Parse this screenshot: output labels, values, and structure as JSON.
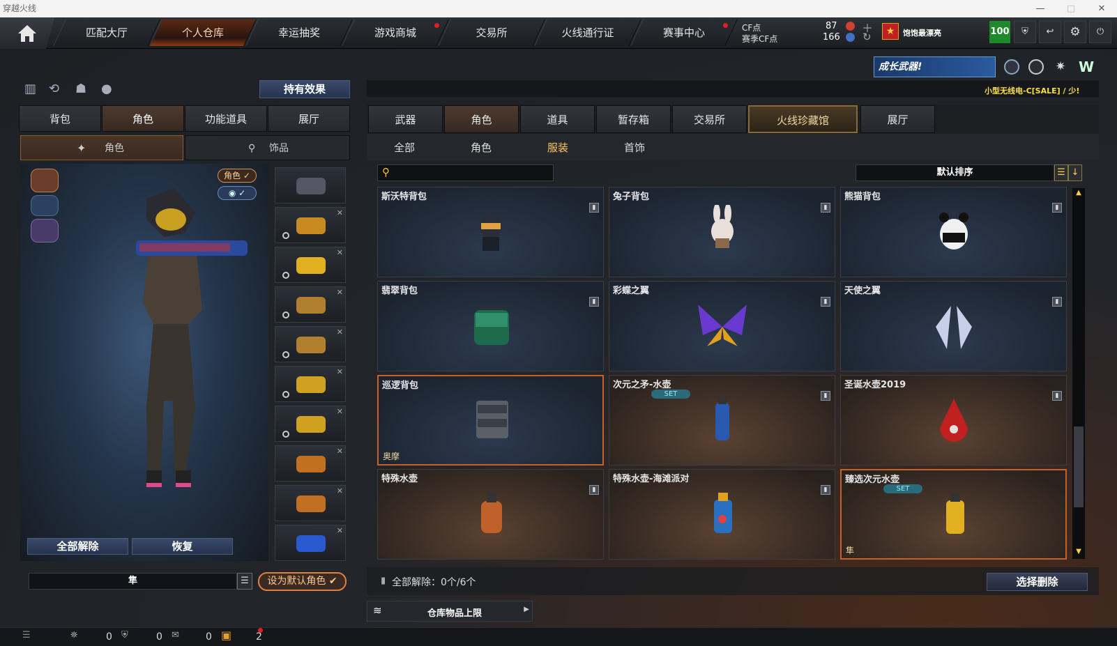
{
  "window": {
    "title": "穿越火线"
  },
  "nav": {
    "tabs": [
      {
        "label": "匹配大厅",
        "dot": false
      },
      {
        "label": "个人仓库",
        "dot": false,
        "active": true
      },
      {
        "label": "幸运抽奖",
        "dot": false
      },
      {
        "label": "游戏商城",
        "dot": true
      },
      {
        "label": "交易所",
        "dot": false
      },
      {
        "label": "火线通行证",
        "dot": false
      },
      {
        "label": "赛事中心",
        "dot": true
      }
    ]
  },
  "currency": {
    "cf_label": "CF点",
    "season_label": "赛季CF点",
    "cf_value": "87",
    "season_value": "166"
  },
  "user": {
    "name": "饱饱最漂亮",
    "level": "100"
  },
  "banner": {
    "text": "成长武器!",
    "sale_text": "小型无线电-C[SALE] / 少!"
  },
  "left": {
    "effects_button": "持有效果",
    "tabs": [
      "背包",
      "角色",
      "功能道具",
      "展厅"
    ],
    "subtabs": [
      "角色",
      "饰品"
    ],
    "role_toggle": "角色",
    "unequip_all": "全部解除",
    "restore": "恢复",
    "char_name": "隼",
    "set_default": "设为默认角色"
  },
  "right": {
    "tabs": [
      "武器",
      "角色",
      "道具",
      "暂存箱",
      "交易所",
      "火线珍藏馆",
      "展厅"
    ],
    "categories": [
      "全部",
      "角色",
      "服装",
      "首饰"
    ],
    "search_placeholder": "",
    "sort_label": "默认排序",
    "items": [
      {
        "name": "斯沃特背包",
        "bg": "blue"
      },
      {
        "name": "兔子背包",
        "bg": "blue"
      },
      {
        "name": "熊猫背包",
        "bg": "blue"
      },
      {
        "name": "翡翠背包",
        "bg": "blue"
      },
      {
        "name": "彩蝶之翼",
        "bg": "blue"
      },
      {
        "name": "天使之翼",
        "bg": "blue"
      },
      {
        "name": "巡逻背包",
        "bg": "blue",
        "tag": "奥摩",
        "selected": true
      },
      {
        "name": "次元之矛-水壶",
        "bg": "brown",
        "set": "SET"
      },
      {
        "name": "圣诞水壶2019",
        "bg": "brown"
      },
      {
        "name": "特殊水壶",
        "bg": "brown"
      },
      {
        "name": "特殊水壶-海滩派对",
        "bg": "brown"
      },
      {
        "name": "臻选次元水壶",
        "bg": "brown",
        "set": "SET",
        "tag": "隼",
        "selected": true
      }
    ],
    "unequip_status": "全部解除：0个/6个",
    "select_delete": "选择删除",
    "storage_limit": "仓库物品上限"
  },
  "bottom": {
    "counts": [
      "0",
      "0",
      "0",
      "2"
    ]
  }
}
